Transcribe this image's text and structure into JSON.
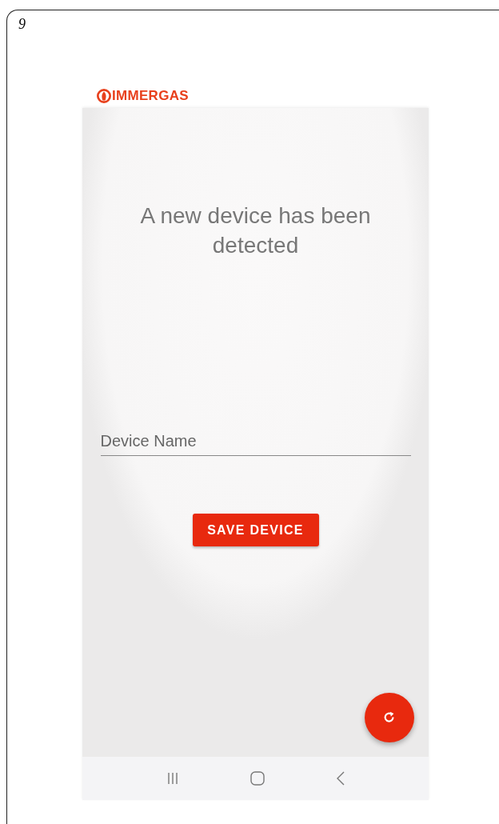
{
  "figure_number": "9",
  "brand": {
    "name": "IMMERGAS"
  },
  "screen": {
    "title": "A new device has been detected",
    "device_name_field": {
      "placeholder": "Device Name"
    },
    "save_button": "SAVE DEVICE"
  }
}
